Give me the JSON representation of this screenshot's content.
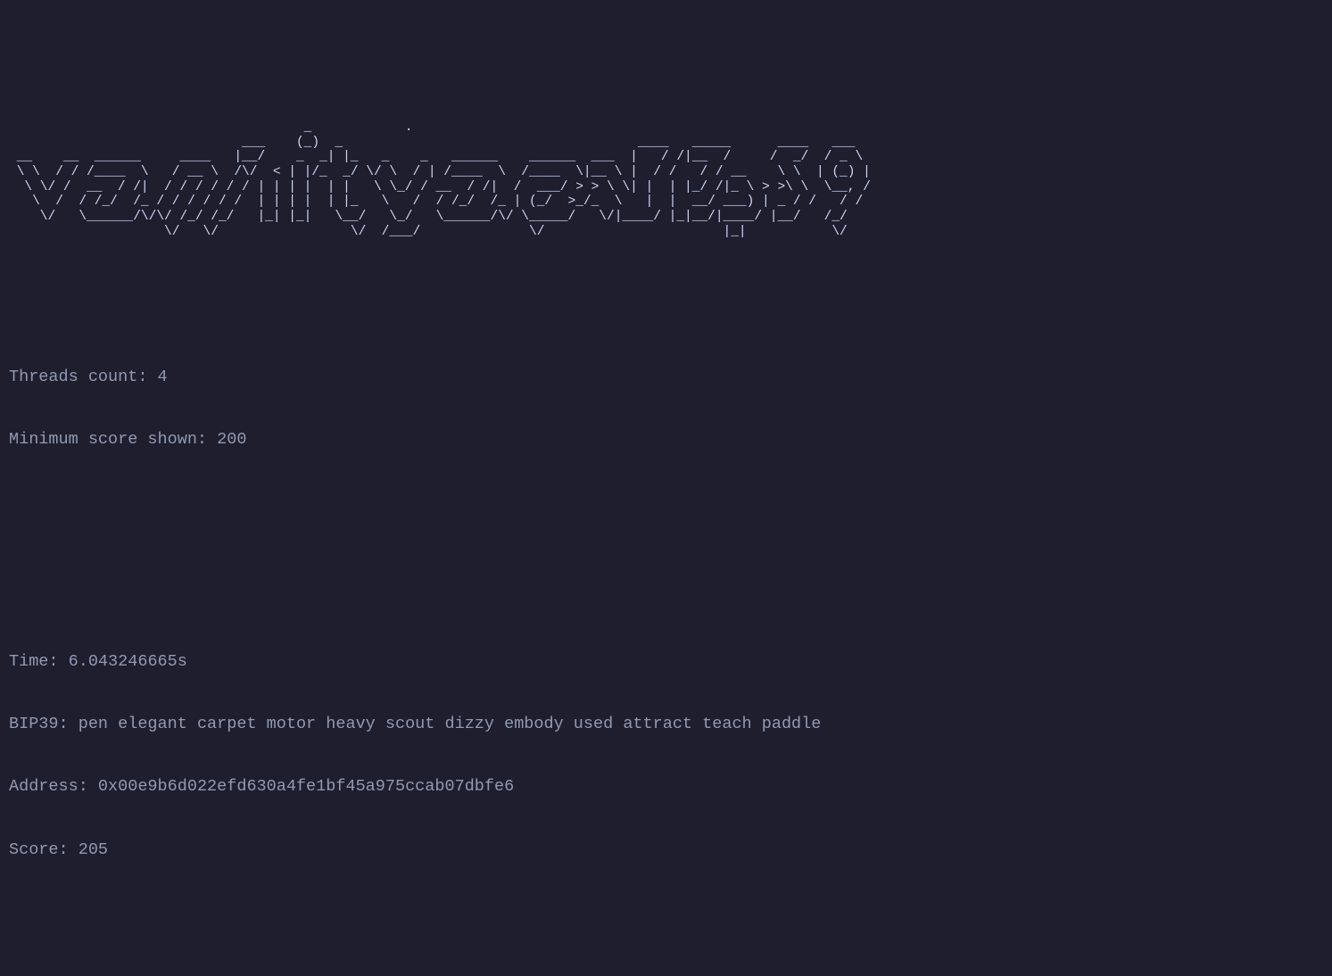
{
  "banner_ascii": "                                      _            .\n                              ___    (_)  _                                      ____   _____      ____   ___\n __    __  ______     ____   |__/    _  _| |_   _    _   ______    ______  ___  |   / /|__  /     /  _/  / _ \\\n \\ \\  / / /____  \\   / __ \\  /\\/  < | |/_  _/ \\/ \\  / | /____  \\  /____  \\|__ \\ |  / /   / / __    \\ \\  | (_) |\n  \\ \\/ /  __  / /|  / / / / / / | | | |  | |   \\ \\_/ / __  / /|  /  ___/ > > \\ \\| |  | |_/ /|_ \\ > >\\ \\  \\__, /\n   \\  /  / /_/  /_ / / / / / /  | | | |  | |_   \\   /  / /_/  /_ | (_/  >_/_  \\   |  |  __/ ___) | _ / /   / /\n    \\/   \\______/\\/\\/ /_/ /_/   |_| |_|   \\__/   \\_/   \\______/\\/ \\_____/   \\/|____/ |_|__/|____/ |__/   /_/\n                    \\/   \\/                 \\/  /___/              \\/                       |_|           \\/",
  "config": {
    "threads_label": "Threads count: ",
    "threads_value": "4",
    "min_score_label": "Minimum score shown: ",
    "min_score_value": "200"
  },
  "result": {
    "time_label": "Time: ",
    "time_value": "6.043246665s",
    "bip39_label": "BIP39: ",
    "bip39_value": "pen elegant carpet motor heavy scout dizzy embody used attract teach paddle",
    "address_label": "Address: ",
    "address_value": "0x00e9b6d022efd630a4fe1bf45a975ccab07dbfe6",
    "score_label": "Score: ",
    "score_value": "205"
  }
}
